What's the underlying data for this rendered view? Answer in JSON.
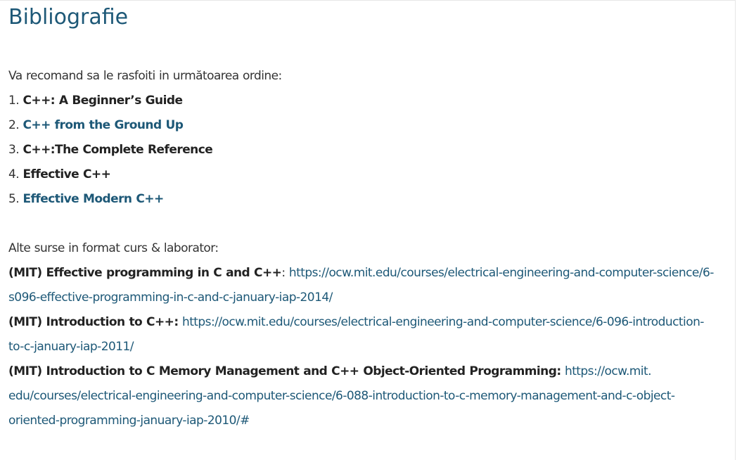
{
  "page": {
    "title": "Bibliografie"
  },
  "bibliography": {
    "intro": "Va recomand sa le rasfoiti in următoarea ordine:",
    "books": [
      {
        "number": "1.",
        "title": "C++: A Beginner’s Guide"
      },
      {
        "number": "2.",
        "title": "C++ from the Ground Up"
      },
      {
        "number": "3.",
        "title": "C++:The Complete Reference"
      },
      {
        "number": "4.",
        "title": "Effective C++"
      },
      {
        "number": "5.",
        "title": "Effective Modern C++"
      }
    ]
  },
  "sources": {
    "intro": "Alte surse in format curs & laborator:",
    "items": [
      {
        "label": "(MIT) Effective programming in C and C++",
        "separator": ":",
        "url_part1": "https://ocw.mit.edu/courses/electrical-engineering-and-computer-science/6-",
        "url_part2": "s096-effective-programming-in-c-and-c-january-iap-2014/"
      },
      {
        "label": "(MIT) Introduction to C++:",
        "url_part1": "https://ocw.mit.edu/courses/electrical-engineering-and-computer-science/6-096-introduction-",
        "url_part2": "to-c-january-iap-2011/"
      },
      {
        "label": "(MIT) Introduction to C Memory Management and C++ Object-Oriented Programming:",
        "url_part1": "https://ocw.mit.",
        "url_part2": "edu/courses/electrical-engineering-and-computer-science/6-088-introduction-to-c-memory-management-and-c-object-",
        "url_part3": "oriented-programming-january-iap-2010/#"
      }
    ]
  },
  "colors": {
    "title": "#1d5877",
    "link": "#1d5877",
    "text": "#333333",
    "bold_text": "#222222",
    "border": "#e6e6e6"
  }
}
